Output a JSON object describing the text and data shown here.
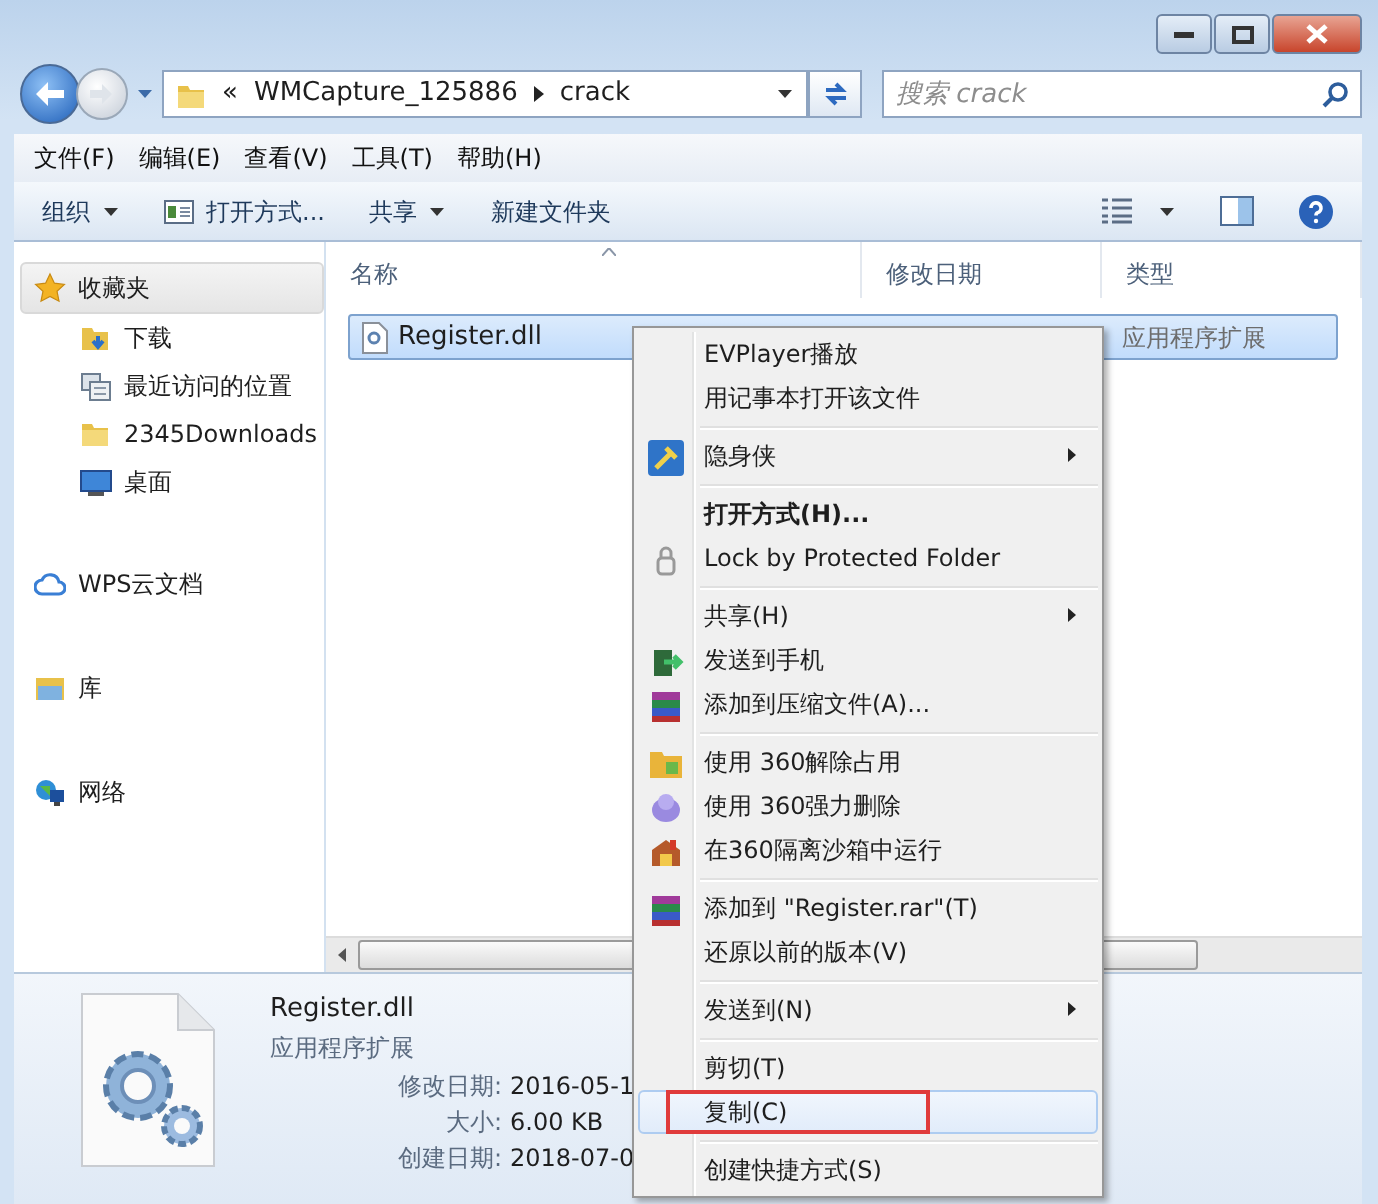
{
  "address_bar": {
    "prefix": "«",
    "path": [
      "WMCapture_125886",
      "crack"
    ]
  },
  "search": {
    "placeholder": "搜索 crack"
  },
  "menu_bar": [
    "文件(F)",
    "编辑(E)",
    "查看(V)",
    "工具(T)",
    "帮助(H)"
  ],
  "toolbar": [
    {
      "label": "组织",
      "kind": "dropdown"
    },
    {
      "label": "打开方式...",
      "kind": "icon-button"
    },
    {
      "label": "共享",
      "kind": "dropdown"
    },
    {
      "label": "新建文件夹",
      "kind": "button"
    }
  ],
  "navigation": [
    {
      "label": "收藏夹",
      "selected": true,
      "children": [
        {
          "label": "下载"
        },
        {
          "label": "最近访问的位置"
        },
        {
          "label": "2345Downloads"
        },
        {
          "label": "桌面"
        }
      ]
    },
    {
      "label": "WPS云文档",
      "selected": false
    },
    {
      "label": "库",
      "selected": false
    },
    {
      "label": "网络",
      "selected": false
    }
  ],
  "columns": [
    "名称",
    "修改日期",
    "类型"
  ],
  "files": [
    {
      "name": "Register.dll",
      "type": "应用程序扩展",
      "selected": true
    }
  ],
  "details": {
    "name": "Register.dll",
    "type": "应用程序扩展",
    "fields": [
      {
        "label": "修改日期:",
        "value": "2016-05-1"
      },
      {
        "label": "大小:",
        "value": "6.00 KB"
      },
      {
        "label": "创建日期:",
        "value": "2018-07-0"
      }
    ]
  },
  "context_menu": [
    {
      "kind": "item",
      "label": "EVPlayer播放",
      "bold": false,
      "submenu": false,
      "hovered": false
    },
    {
      "kind": "item",
      "label": "用记事本打开该文件",
      "bold": false,
      "submenu": false,
      "hovered": false
    },
    {
      "kind": "separator"
    },
    {
      "kind": "item",
      "label": "隐身侠",
      "bold": false,
      "submenu": true,
      "hovered": false
    },
    {
      "kind": "separator"
    },
    {
      "kind": "item",
      "label": "打开方式(H)...",
      "bold": true,
      "submenu": false,
      "hovered": false
    },
    {
      "kind": "item",
      "label": "Lock by Protected Folder",
      "bold": false,
      "submenu": false,
      "hovered": false
    },
    {
      "kind": "separator"
    },
    {
      "kind": "item",
      "label": "共享(H)",
      "bold": false,
      "submenu": true,
      "hovered": false
    },
    {
      "kind": "item",
      "label": "发送到手机",
      "bold": false,
      "submenu": false,
      "hovered": false
    },
    {
      "kind": "item",
      "label": "添加到压缩文件(A)...",
      "bold": false,
      "submenu": false,
      "hovered": false
    },
    {
      "kind": "separator"
    },
    {
      "kind": "item",
      "label": "使用 360解除占用",
      "bold": false,
      "submenu": false,
      "hovered": false
    },
    {
      "kind": "item",
      "label": "使用 360强力删除",
      "bold": false,
      "submenu": false,
      "hovered": false
    },
    {
      "kind": "item",
      "label": "在360隔离沙箱中运行",
      "bold": false,
      "submenu": false,
      "hovered": false
    },
    {
      "kind": "separator"
    },
    {
      "kind": "item",
      "label": "添加到 \"Register.rar\"(T)",
      "bold": false,
      "submenu": false,
      "hovered": false
    },
    {
      "kind": "item",
      "label": "还原以前的版本(V)",
      "bold": false,
      "submenu": false,
      "hovered": false
    },
    {
      "kind": "separator"
    },
    {
      "kind": "item",
      "label": "发送到(N)",
      "bold": false,
      "submenu": true,
      "hovered": false
    },
    {
      "kind": "separator"
    },
    {
      "kind": "item",
      "label": "剪切(T)",
      "bold": false,
      "submenu": false,
      "hovered": false
    },
    {
      "kind": "item",
      "label": "复制(C)",
      "bold": false,
      "submenu": false,
      "hovered": true
    },
    {
      "kind": "separator"
    },
    {
      "kind": "item",
      "label": "创建快捷方式(S)",
      "bold": false,
      "submenu": false,
      "hovered": false
    }
  ]
}
